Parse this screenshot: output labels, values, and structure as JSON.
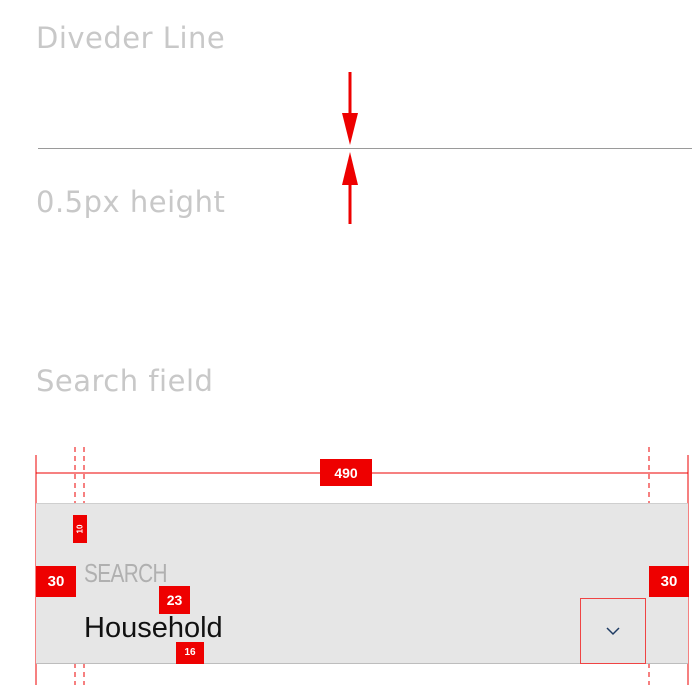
{
  "sections": {
    "divider_title": "Diveder Line",
    "divider_caption": "0.5px height",
    "search_title": "Search field"
  },
  "search_field": {
    "label": "SEARCH",
    "value": "Household",
    "icon": "chevron-down-icon"
  },
  "annotations": {
    "width_total": "490",
    "padding_left": "30",
    "padding_right": "30",
    "top_offset": "10",
    "label_value_gap": "23",
    "bottom_offset": "16"
  },
  "colors": {
    "annotation_red": "#ee0000",
    "field_background": "#e6e6e6",
    "divider_gray": "#9a9a9a",
    "title_gray": "#c8c8c8",
    "label_gray": "#b0b0b0",
    "chevron_color": "#1f3b63"
  }
}
